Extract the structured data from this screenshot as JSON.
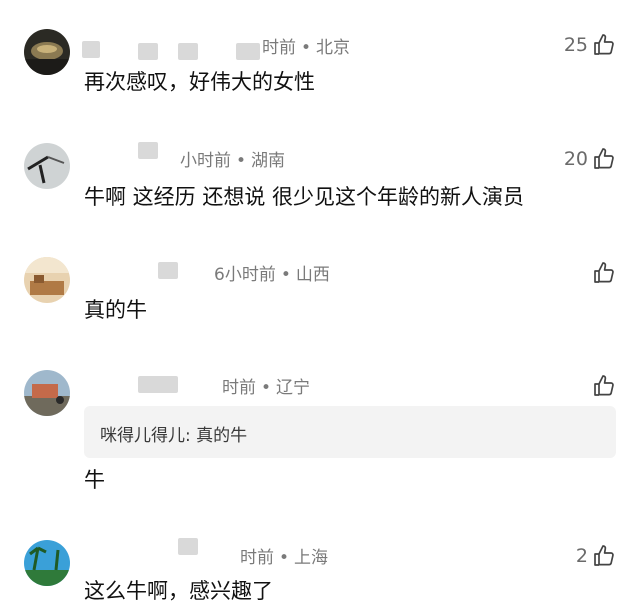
{
  "comments": [
    {
      "time": "时前",
      "location": "北京",
      "likes": "25",
      "text": "再次感叹，好伟大的女性"
    },
    {
      "time": "小时前",
      "location": "湖南",
      "likes": "20",
      "text": "牛啊 这经历 还想说 很少见这个年龄的新人演员"
    },
    {
      "time": "6小时前",
      "location": "山西",
      "likes": "",
      "text": "真的牛"
    },
    {
      "time": "时前",
      "location": "辽宁",
      "likes": "",
      "reply": "咪得儿得儿: 真的牛",
      "text": "牛"
    },
    {
      "time": "时前",
      "location": "上海",
      "likes": "2",
      "text": "这么牛啊，感兴趣了"
    }
  ],
  "separator": "•",
  "icons": {
    "like": "thumbs-up-icon"
  }
}
